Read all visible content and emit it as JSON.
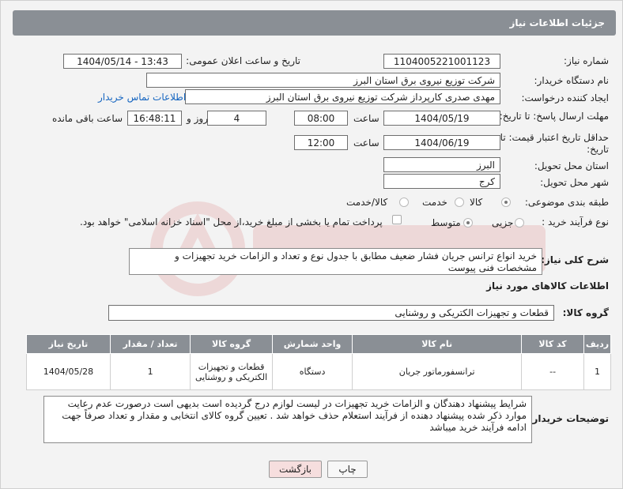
{
  "header": {
    "title": "جزئیات اطلاعات نیاز"
  },
  "labels": {
    "need_number": "شماره نیاز:",
    "announce_datetime": "تاریخ و ساعت اعلان عمومی:",
    "buyer_org": "نام دستگاه خریدار:",
    "requester": "ایجاد کننده درخواست:",
    "contact_link": "اطلاعات تماس خریدار",
    "response_deadline": "مهلت ارسال پاسخ: تا تاریخ:",
    "price_validity": "حداقل تاریخ اعتبار قیمت: تا تاریخ:",
    "time": "ساعت",
    "days_and": "روز و",
    "time_remaining": "ساعت باقی مانده",
    "delivery_province": "استان محل تحویل:",
    "delivery_city": "شهر محل تحویل:",
    "category": "طبقه بندی موضوعی:",
    "process_type": "نوع فرآیند خرید :",
    "payment_note": "پرداخت تمام یا بخشی از مبلغ خرید،از محل \"اسناد خزانه اسلامی\" خواهد بود.",
    "general_desc": "شرح کلی نیاز:",
    "goods_info": "اطلاعات کالاهای مورد نیاز",
    "goods_group": "گروه کالا:",
    "buyer_notes": "توضیحات خریدار:"
  },
  "values": {
    "need_number": "1104005221001123",
    "announce_datetime": "1404/05/14 - 13:43",
    "buyer_org": "شرکت توزیع نیروی برق استان البرز",
    "requester": "مهدی صدری کارپرداز شرکت توزیع نیروی برق استان البرز",
    "response_date": "1404/05/19",
    "response_time": "08:00",
    "days": "4",
    "remaining_time": "16:48:11",
    "validity_date": "1404/06/19",
    "validity_time": "12:00",
    "province": "البرز",
    "city": "کرج",
    "general_desc": "خرید انواع ترانس جریان فشار ضعیف مطابق با جدول نوع و تعداد و الزامات خرید تجهیزات و مشخصات فنی پیوست",
    "goods_group": "قطعات و تجهیزات الکتریکی و روشنایی",
    "buyer_notes": "شرایط پیشنهاد دهندگان و الزامات خرید تجهیزات در لیست لوازم درج گردیده است بدیهی است درصورت عدم رعایت موارد ذکر شده پیشنهاد دهنده از فرآیند استعلام حذف خواهد شد . تعیین گروه کالای انتخابی و مقدار و تعداد صرفاً جهت ادامه فرآیند خرید میباشد"
  },
  "category_options": [
    {
      "label": "کالا",
      "selected": true
    },
    {
      "label": "خدمت",
      "selected": false
    },
    {
      "label": "کالا/خدمت",
      "selected": false
    }
  ],
  "process_options": [
    {
      "label": "جزیی",
      "selected": false
    },
    {
      "label": "متوسط",
      "selected": true
    }
  ],
  "table": {
    "headers": [
      "ردیف",
      "کد کالا",
      "نام کالا",
      "واحد شمارش",
      "گروه کالا",
      "تعداد / مقدار",
      "تاریخ نیاز"
    ],
    "rows": [
      [
        "1",
        "--",
        "ترانسفورماتور جریان",
        "دستگاه",
        "قطعات و تجهیزات الکتریکی و روشنایی",
        "1",
        "1404/05/28"
      ]
    ]
  },
  "buttons": {
    "print": "چاپ",
    "back": "بازگشت"
  },
  "colors": {
    "header_bg": "#8a8f95",
    "link": "#1565c0",
    "back_bg": "#f6dede",
    "watermark": "#c62828"
  }
}
